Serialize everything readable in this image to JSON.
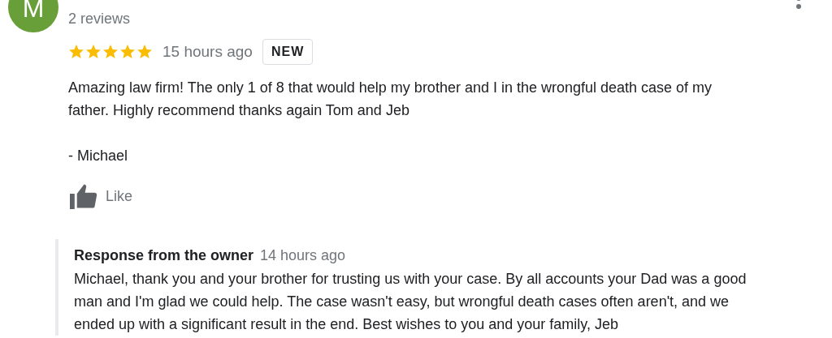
{
  "reviewer": {
    "initial": "M",
    "reviews": "2 reviews"
  },
  "review": {
    "stars": 5,
    "time": "15 hours ago",
    "badge": "NEW",
    "text": "Amazing law firm! The only 1 of 8 that would help my brother and I in the wrongful death case of my\nfather. Highly recommend thanks again Tom and Jeb\n\n- Michael",
    "like": "Like"
  },
  "response": {
    "title": "Response from the owner",
    "time": "14 hours ago",
    "text": "Michael, thank you and your brother for trusting us with your case. By all accounts your Dad was a good\nman and I'm glad we could help. The case wasn't easy, but wrongful death cases often aren't, and we\nended up with a significant result in the end. Best wishes to you and your family, Jeb"
  }
}
